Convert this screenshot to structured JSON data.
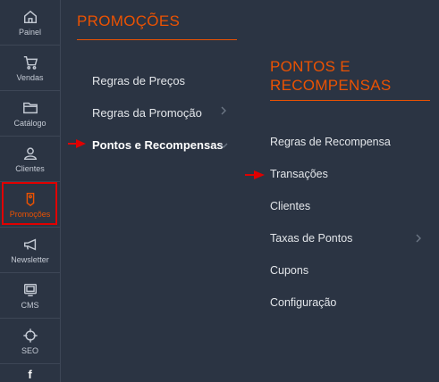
{
  "sidebar": {
    "items": [
      {
        "label": "Painel",
        "icon": "home-icon"
      },
      {
        "label": "Vendas",
        "icon": "cart-icon"
      },
      {
        "label": "Catálogo",
        "icon": "folder-icon"
      },
      {
        "label": "Clientes",
        "icon": "person-icon"
      },
      {
        "label": "Promoções",
        "icon": "tag-icon"
      },
      {
        "label": "Newsletter",
        "icon": "megaphone-icon"
      },
      {
        "label": "CMS",
        "icon": "monitor-icon"
      },
      {
        "label": "SEO",
        "icon": "crosshair-icon"
      }
    ],
    "active_item": "Promoções"
  },
  "promo_panel": {
    "title": "PROMOÇÕES",
    "items": [
      {
        "label": "Regras de Preços",
        "has_submenu": false
      },
      {
        "label": "Regras da Promoção",
        "has_submenu": true
      },
      {
        "label": "Pontos e Recompensas",
        "has_submenu": true,
        "expanded": true
      }
    ]
  },
  "sub_panel": {
    "title": "PONTOS E RECOMPENSAS",
    "items": [
      {
        "label": "Regras de Recompensa",
        "has_submenu": false
      },
      {
        "label": "Transações",
        "has_submenu": false
      },
      {
        "label": "Clientes",
        "has_submenu": false
      },
      {
        "label": "Taxas de Pontos",
        "has_submenu": true
      },
      {
        "label": "Cupons",
        "has_submenu": false
      },
      {
        "label": "Configuração",
        "has_submenu": false
      }
    ]
  },
  "colors": {
    "background": "#2b3443",
    "accent": "#eb5202",
    "annotation": "#e00000",
    "text": "#e3e6ea"
  }
}
